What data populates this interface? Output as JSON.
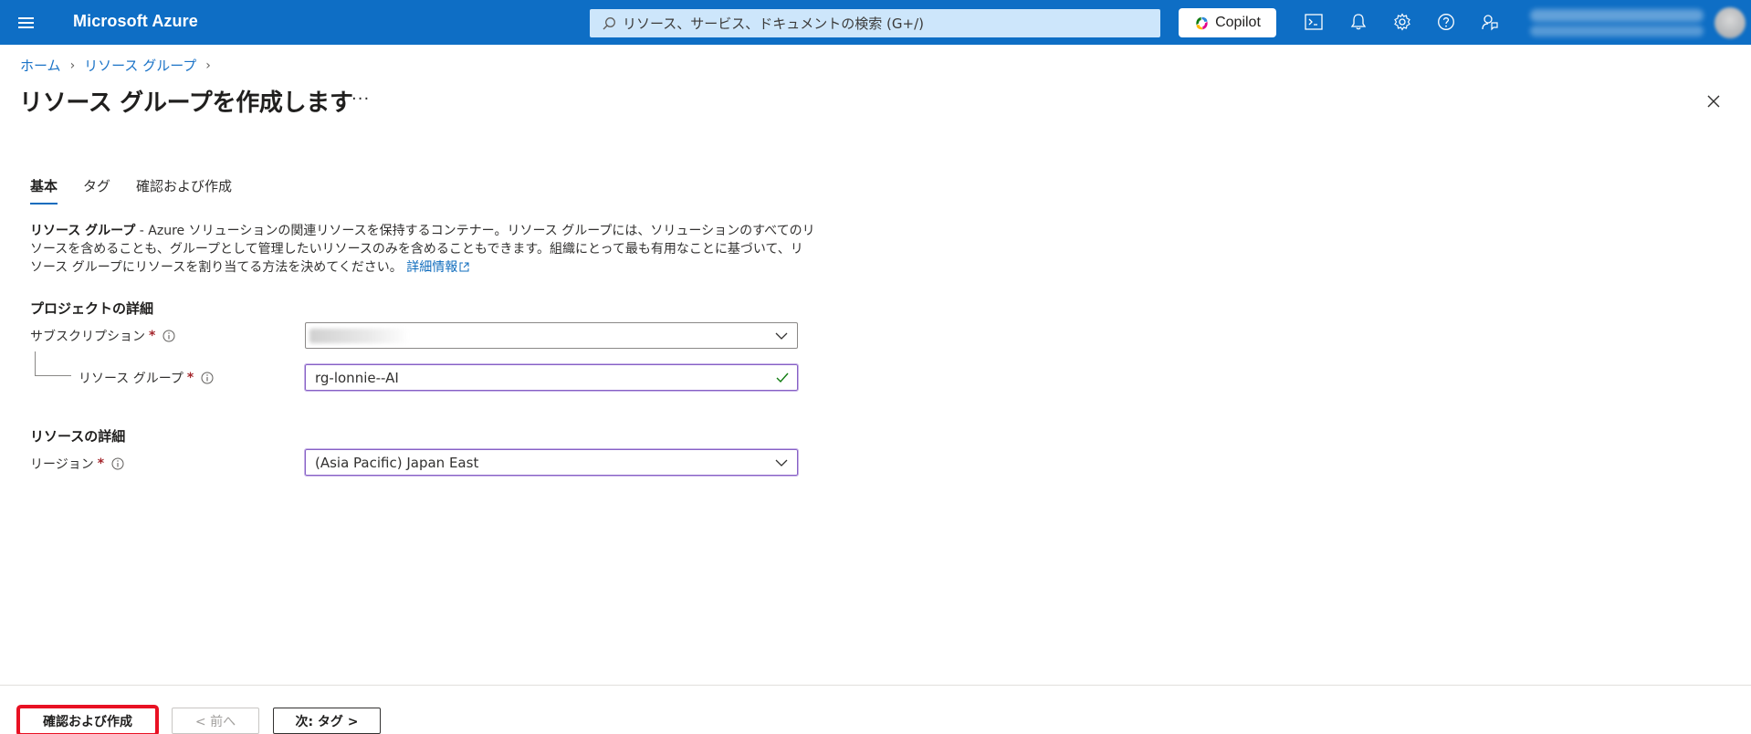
{
  "header": {
    "brand": "Microsoft Azure",
    "search_placeholder": "リソース、サービス、ドキュメントの検索 (G+/)",
    "copilot_label": "Copilot",
    "icons": [
      "cloud-shell-icon",
      "bell-icon",
      "gear-icon",
      "help-icon",
      "feedback-icon"
    ]
  },
  "breadcrumb": {
    "items": [
      "ホーム",
      "リソース グループ"
    ]
  },
  "page": {
    "title": "リソース グループを作成します",
    "more": "···"
  },
  "tabs": [
    {
      "label": "基本",
      "active": true
    },
    {
      "label": "タグ",
      "active": false
    },
    {
      "label": "確認および作成",
      "active": false
    }
  ],
  "description": {
    "bold": "リソース グループ",
    "text": " - Azure ソリューションの関連リソースを保持するコンテナー。リソース グループには、ソリューションのすべてのリソースを含めることも、グループとして管理したいリソースのみを含めることもできます。組織にとって最も有用なことに基づいて、リソース グループにリソースを割り当てる方法を決めてください。",
    "link": "詳細情報"
  },
  "project": {
    "heading": "プロジェクトの詳細",
    "subscription_label": "サブスクリプション",
    "resource_group_label": "リソース グループ",
    "resource_group_value": "rg-lonnie--AI"
  },
  "resource": {
    "heading": "リソースの詳細",
    "region_label": "リージョン",
    "region_value": "(Asia Pacific) Japan East"
  },
  "required_mark": "*",
  "footer": {
    "review_create": "確認および作成",
    "prev": "< 前へ",
    "next": "次: タグ >"
  },
  "colors": {
    "topbar": "#0e6ec5",
    "accent": "#0f6cbd",
    "highlight": "#e81123",
    "focus_border": "#8661c5",
    "valid_check": "#107c10"
  }
}
